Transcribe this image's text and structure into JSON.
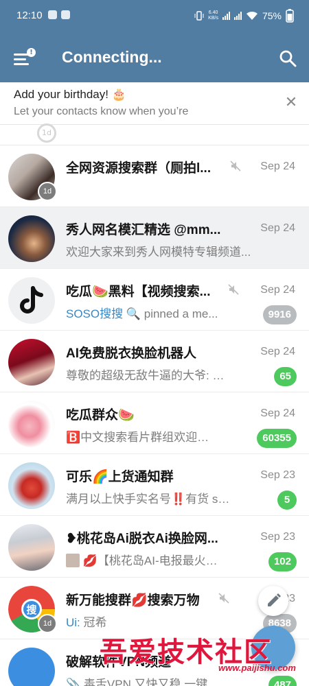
{
  "status_bar": {
    "time": "12:10",
    "net_speed_value": "6.40",
    "net_speed_unit": "KB/s",
    "battery": "75%"
  },
  "app_bar": {
    "title": "Connecting...",
    "menu_icon": "menu-with-alert-icon",
    "search_icon": "search-icon",
    "color": "#527da3"
  },
  "banner": {
    "title": "Add your birthday! 🎂",
    "subtitle": "Let your contacts know when you’re",
    "close_icon": "close-icon"
  },
  "partial_row": {
    "badge": "1d"
  },
  "chats": [
    {
      "name": "全网资源搜索群（厕拍l...",
      "muted": true,
      "date": "Sep 24",
      "preview": "",
      "sender": "",
      "unread": "",
      "badge_color": "",
      "avatar_badge": "1d",
      "highlight": false
    },
    {
      "name": "秀人网名模汇精选 @mm...",
      "muted": false,
      "date": "Sep 24",
      "preview": "欢迎大家来到秀人网模特专辑频道...",
      "sender": "",
      "unread": "",
      "badge_color": "",
      "avatar_badge": "",
      "highlight": true
    },
    {
      "name": "吃瓜🍉黑料【视频搜索...",
      "muted": true,
      "date": "Sep 24",
      "preview": " pinned a me...",
      "sender": "SOSO搜搜 🔍",
      "unread": "9916",
      "badge_color": "grey",
      "avatar_badge": "",
      "highlight": false
    },
    {
      "name": "AI免费脱衣换脸机器人",
      "muted": false,
      "date": "Sep 24",
      "preview": "尊敬的超级无敌牛逼的大爷: …",
      "sender": "",
      "unread": "65",
      "badge_color": "green",
      "avatar_badge": "",
      "highlight": false
    },
    {
      "name": "吃瓜群众🍉",
      "muted": false,
      "date": "Sep 24",
      "preview": "🅱️中文搜索看片群组欢迎…",
      "sender": "",
      "unread": "60355",
      "badge_color": "green",
      "avatar_badge": "",
      "highlight": false
    },
    {
      "name": "可乐🌈上货通知群",
      "muted": false,
      "date": "Sep 23",
      "preview": "满月以上快手实名号‼️有货 s…",
      "sender": "",
      "unread": "5",
      "badge_color": "green",
      "avatar_badge": "",
      "highlight": false
    },
    {
      "name": "❥桃花岛Ai脱衣Ai换脸网...",
      "muted": false,
      "date": "Sep 23",
      "preview": "💋【桃花岛AI-电报最火…",
      "sender": "",
      "unread": "102",
      "badge_color": "green",
      "avatar_badge": "",
      "highlight": false
    },
    {
      "name": "新万能搜群💋搜索万物",
      "muted": true,
      "date": "Sep 23",
      "preview": " 冠希",
      "sender": "Ui:",
      "unread": "8638",
      "badge_color": "grey",
      "avatar_badge": "1d",
      "highlight": false
    },
    {
      "name": "破解软件VPN频道",
      "muted": false,
      "date": "",
      "preview": "📎 毒舌VPN 又快又稳 一键…",
      "sender": "",
      "unread": "487",
      "badge_color": "green",
      "avatar_badge": "",
      "highlight": false
    }
  ],
  "fab": {
    "pencil_icon": "pencil-icon"
  },
  "watermark": {
    "title": "吾爱技术社区",
    "url": "www.paijishu.com"
  }
}
